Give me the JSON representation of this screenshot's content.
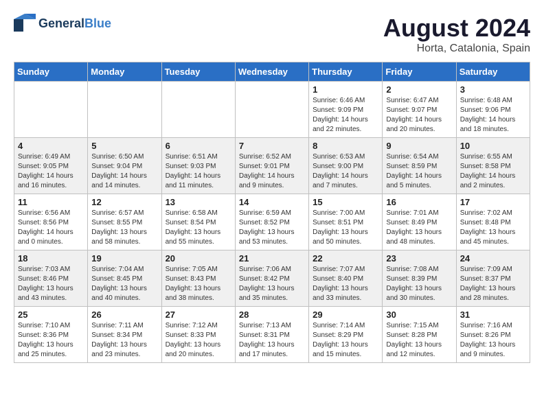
{
  "logo": {
    "general": "General",
    "blue": "Blue",
    "tagline": ""
  },
  "title": "August 2024",
  "subtitle": "Horta, Catalonia, Spain",
  "weekdays": [
    "Sunday",
    "Monday",
    "Tuesday",
    "Wednesday",
    "Thursday",
    "Friday",
    "Saturday"
  ],
  "weeks": [
    [
      {
        "day": "",
        "info": ""
      },
      {
        "day": "",
        "info": ""
      },
      {
        "day": "",
        "info": ""
      },
      {
        "day": "",
        "info": ""
      },
      {
        "day": "1",
        "info": "Sunrise: 6:46 AM\nSunset: 9:09 PM\nDaylight: 14 hours\nand 22 minutes."
      },
      {
        "day": "2",
        "info": "Sunrise: 6:47 AM\nSunset: 9:07 PM\nDaylight: 14 hours\nand 20 minutes."
      },
      {
        "day": "3",
        "info": "Sunrise: 6:48 AM\nSunset: 9:06 PM\nDaylight: 14 hours\nand 18 minutes."
      }
    ],
    [
      {
        "day": "4",
        "info": "Sunrise: 6:49 AM\nSunset: 9:05 PM\nDaylight: 14 hours\nand 16 minutes."
      },
      {
        "day": "5",
        "info": "Sunrise: 6:50 AM\nSunset: 9:04 PM\nDaylight: 14 hours\nand 14 minutes."
      },
      {
        "day": "6",
        "info": "Sunrise: 6:51 AM\nSunset: 9:03 PM\nDaylight: 14 hours\nand 11 minutes."
      },
      {
        "day": "7",
        "info": "Sunrise: 6:52 AM\nSunset: 9:01 PM\nDaylight: 14 hours\nand 9 minutes."
      },
      {
        "day": "8",
        "info": "Sunrise: 6:53 AM\nSunset: 9:00 PM\nDaylight: 14 hours\nand 7 minutes."
      },
      {
        "day": "9",
        "info": "Sunrise: 6:54 AM\nSunset: 8:59 PM\nDaylight: 14 hours\nand 5 minutes."
      },
      {
        "day": "10",
        "info": "Sunrise: 6:55 AM\nSunset: 8:58 PM\nDaylight: 14 hours\nand 2 minutes."
      }
    ],
    [
      {
        "day": "11",
        "info": "Sunrise: 6:56 AM\nSunset: 8:56 PM\nDaylight: 14 hours\nand 0 minutes."
      },
      {
        "day": "12",
        "info": "Sunrise: 6:57 AM\nSunset: 8:55 PM\nDaylight: 13 hours\nand 58 minutes."
      },
      {
        "day": "13",
        "info": "Sunrise: 6:58 AM\nSunset: 8:54 PM\nDaylight: 13 hours\nand 55 minutes."
      },
      {
        "day": "14",
        "info": "Sunrise: 6:59 AM\nSunset: 8:52 PM\nDaylight: 13 hours\nand 53 minutes."
      },
      {
        "day": "15",
        "info": "Sunrise: 7:00 AM\nSunset: 8:51 PM\nDaylight: 13 hours\nand 50 minutes."
      },
      {
        "day": "16",
        "info": "Sunrise: 7:01 AM\nSunset: 8:49 PM\nDaylight: 13 hours\nand 48 minutes."
      },
      {
        "day": "17",
        "info": "Sunrise: 7:02 AM\nSunset: 8:48 PM\nDaylight: 13 hours\nand 45 minutes."
      }
    ],
    [
      {
        "day": "18",
        "info": "Sunrise: 7:03 AM\nSunset: 8:46 PM\nDaylight: 13 hours\nand 43 minutes."
      },
      {
        "day": "19",
        "info": "Sunrise: 7:04 AM\nSunset: 8:45 PM\nDaylight: 13 hours\nand 40 minutes."
      },
      {
        "day": "20",
        "info": "Sunrise: 7:05 AM\nSunset: 8:43 PM\nDaylight: 13 hours\nand 38 minutes."
      },
      {
        "day": "21",
        "info": "Sunrise: 7:06 AM\nSunset: 8:42 PM\nDaylight: 13 hours\nand 35 minutes."
      },
      {
        "day": "22",
        "info": "Sunrise: 7:07 AM\nSunset: 8:40 PM\nDaylight: 13 hours\nand 33 minutes."
      },
      {
        "day": "23",
        "info": "Sunrise: 7:08 AM\nSunset: 8:39 PM\nDaylight: 13 hours\nand 30 minutes."
      },
      {
        "day": "24",
        "info": "Sunrise: 7:09 AM\nSunset: 8:37 PM\nDaylight: 13 hours\nand 28 minutes."
      }
    ],
    [
      {
        "day": "25",
        "info": "Sunrise: 7:10 AM\nSunset: 8:36 PM\nDaylight: 13 hours\nand 25 minutes."
      },
      {
        "day": "26",
        "info": "Sunrise: 7:11 AM\nSunset: 8:34 PM\nDaylight: 13 hours\nand 23 minutes."
      },
      {
        "day": "27",
        "info": "Sunrise: 7:12 AM\nSunset: 8:33 PM\nDaylight: 13 hours\nand 20 minutes."
      },
      {
        "day": "28",
        "info": "Sunrise: 7:13 AM\nSunset: 8:31 PM\nDaylight: 13 hours\nand 17 minutes."
      },
      {
        "day": "29",
        "info": "Sunrise: 7:14 AM\nSunset: 8:29 PM\nDaylight: 13 hours\nand 15 minutes."
      },
      {
        "day": "30",
        "info": "Sunrise: 7:15 AM\nSunset: 8:28 PM\nDaylight: 13 hours\nand 12 minutes."
      },
      {
        "day": "31",
        "info": "Sunrise: 7:16 AM\nSunset: 8:26 PM\nDaylight: 13 hours\nand 9 minutes."
      }
    ]
  ]
}
